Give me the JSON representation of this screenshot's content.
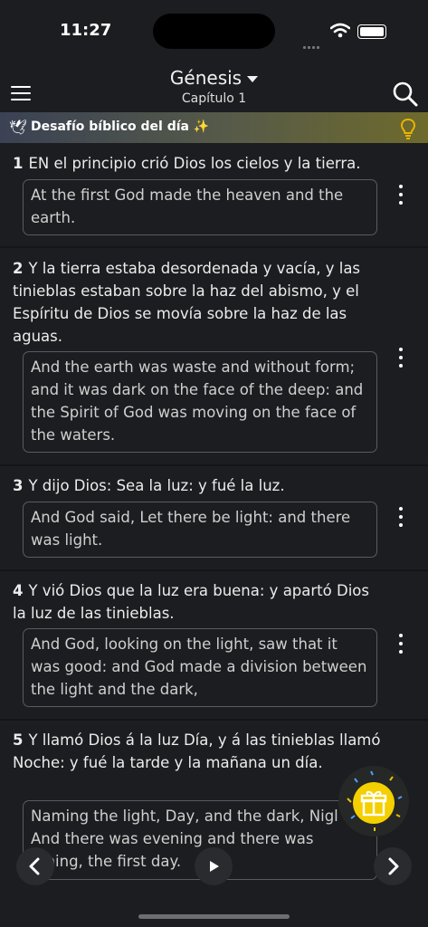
{
  "status_bar": {
    "time": "11:27"
  },
  "header": {
    "book": "Génesis",
    "chapter": "Capítulo 1"
  },
  "banner": {
    "text": "Desafío bíblico del día ✨"
  },
  "verses": [
    {
      "num": "1",
      "text": "EN el principio crió Dios los cielos y la tierra.",
      "translation": "At the first God made the heaven and the earth."
    },
    {
      "num": "2",
      "text": "Y la tierra estaba desordenada y vacía, y las tinieblas estaban sobre la haz del abismo, y el Espíritu de Dios se movía sobre la haz de las aguas.",
      "translation": "And the earth was waste and without form; and it was dark on the face of the deep: and the Spirit of God was moving on the face of the waters."
    },
    {
      "num": "3",
      "text": "Y dijo Dios: Sea la luz: y fué la luz.",
      "translation": "And God said, Let there be light: and there was light."
    },
    {
      "num": "4",
      "text": "Y vió Dios que la luz era buena: y apartó Dios la luz de las tinieblas.",
      "translation": "And God, looking on the light, saw that it was good: and God made a division between the light and the dark,"
    },
    {
      "num": "5",
      "text": "Y llamó Dios á la luz Día, y á las tinieblas llamó Noche: y fué la tarde y la mañana un día.",
      "translation": "Naming the light, Day, and the dark, Nigl And there was evening and there was orning, the first day."
    }
  ],
  "icons": {
    "menu": "hamburger-icon",
    "search": "search-icon",
    "dove": "dove-icon",
    "bulb": "lightbulb-icon",
    "more": "more-vertical-icon",
    "prev": "chevron-left-icon",
    "play": "play-icon",
    "next": "chevron-right-icon",
    "gift": "gift-icon"
  },
  "colors": {
    "accent": "#f4d000",
    "background": "#1c1d20",
    "banner_gold": "#6e6a2c"
  }
}
